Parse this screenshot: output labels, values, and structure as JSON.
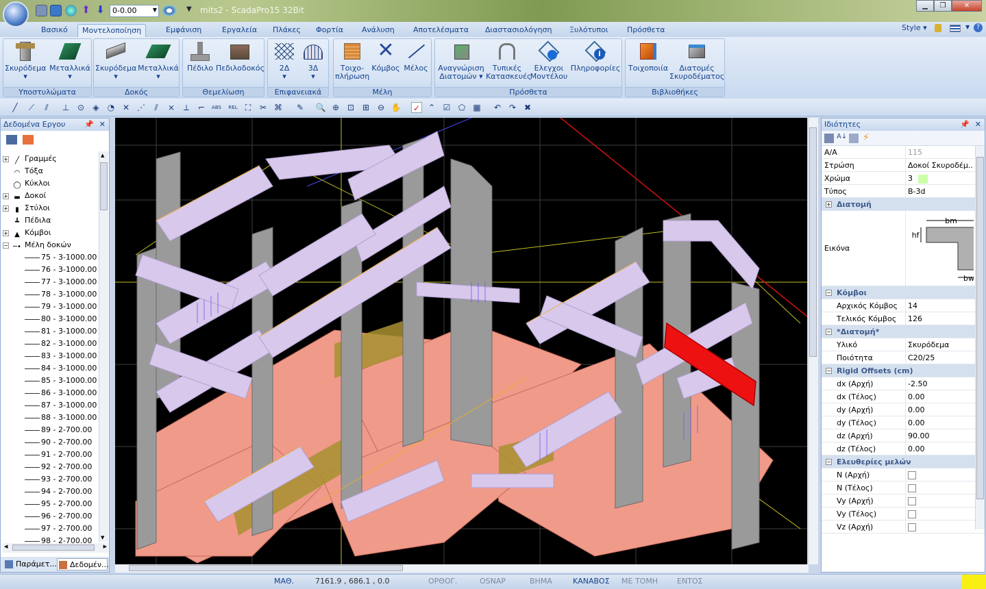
{
  "window": {
    "title": "mits2 - ScadaPro15 32Bit",
    "quick_combo_value": "0-0.00"
  },
  "menu_tabs": [
    "Βασικό",
    "Μοντελοποίηση",
    "Εμφάνιση",
    "Εργαλεία",
    "Πλάκες",
    "Φορτία",
    "Ανάλυση",
    "Αποτελέσματα",
    "Διαστασιολόγηση",
    "Ξυλότυποι",
    "Πρόσθετα"
  ],
  "menu_right": {
    "style_label": "Style"
  },
  "ribbon": {
    "columns": {
      "name": "Υποστυλώματα",
      "b1": "Σκυρόδεμα",
      "b2": "Μεταλλικά"
    },
    "beams": {
      "name": "Δοκός",
      "b1": "Σκυρόδεμα",
      "b2": "Μεταλλικά"
    },
    "foundation": {
      "name": "Θεμελίωση",
      "b1": "Πέδιλο",
      "b2": "Πεδιλοδοκός"
    },
    "surfaces": {
      "name": "Επιφανειακά",
      "b1": "2Δ",
      "b2": "3Δ"
    },
    "members": {
      "name": "Μέλη",
      "b1a": "Τοιχο-",
      "b1b": "πλήρωση",
      "b2": "Κόμβος",
      "b3": "Μέλος"
    },
    "extras": {
      "name": "Πρόσθετα",
      "b1a": "Αναγνώριση",
      "b1b": "Διατομών",
      "b2a": "Τυπικές",
      "b2b": "Κατασκευές",
      "b3a": "Ελεγχοι",
      "b3b": "Μοντέλου",
      "b4": "Πληροφορίες"
    },
    "libraries": {
      "name": "Βιβλιοθήκες",
      "b1": "Τοιχοποιία",
      "b2a": "Διατομές",
      "b2b": "Σκυροδέματος"
    }
  },
  "left_panel": {
    "title": "Δεδομένα Εργου",
    "tree_top": [
      {
        "label": "Γραμμές",
        "icon": "line-icon"
      },
      {
        "label": "Τόξα",
        "icon": "arc-icon"
      },
      {
        "label": "Κύκλοι",
        "icon": "circle-icon"
      },
      {
        "label": "Δοκοί",
        "icon": "beam-icon"
      },
      {
        "label": "Στύλοι",
        "icon": "column-icon"
      },
      {
        "label": "Πέδιλα",
        "icon": "footing-icon"
      },
      {
        "label": "Κόμβοι",
        "icon": "node-icon"
      },
      {
        "label": "Μέλη δοκών",
        "icon": "member-icon"
      }
    ],
    "members": [
      "75 - 3-1000.00",
      "76 - 3-1000.00",
      "77 - 3-1000.00",
      "78 - 3-1000.00",
      "79 - 3-1000.00",
      "80 - 3-1000.00",
      "81 - 3-1000.00",
      "82 - 3-1000.00",
      "83 - 3-1000.00",
      "84 - 3-1000.00",
      "85 - 3-1000.00",
      "86 - 3-1000.00",
      "87 - 3-1000.00",
      "88 - 3-1000.00",
      "89 - 2-700.00",
      "90 - 2-700.00",
      "91 - 2-700.00",
      "92 - 2-700.00",
      "93 - 2-700.00",
      "94 - 2-700.00",
      "95 - 2-700.00",
      "96 - 2-700.00",
      "97 - 2-700.00",
      "98 - 2-700.00"
    ],
    "bottom_tabs": [
      "Παράμετ...",
      "Δεδομέν..."
    ]
  },
  "properties": {
    "title": "Ιδιότητες",
    "aa": {
      "name": "Α/Α",
      "value": "115"
    },
    "layer": {
      "name": "Στρώση",
      "value": "Δοκοί Σκυροδέμ..."
    },
    "color": {
      "name": "Χρώμα",
      "value": "3",
      "swatch": "#ccffaa"
    },
    "type": {
      "name": "Τύπος",
      "value": "B-3d"
    },
    "cat_section": "Διατομή",
    "image": {
      "name": "Εικόνα",
      "bm": "bm",
      "hf": "hf",
      "bw": "bw"
    },
    "cat_nodes": "Κόμβοι",
    "start_node": {
      "name": "Αρχικός Κόμβος",
      "value": "14"
    },
    "end_node": {
      "name": "Τελικός Κόμβος",
      "value": "126"
    },
    "cat_section2": "*Διατομή*",
    "material": {
      "name": "Υλικό",
      "value": "Σκυρόδεμα"
    },
    "quality": {
      "name": "Ποιότητα",
      "value": "C20/25"
    },
    "cat_offsets": "Rigid Offsets (cm)",
    "offsets": [
      {
        "name": "dx (Αρχή)",
        "value": "-2.50"
      },
      {
        "name": "dx (Τέλος)",
        "value": "0.00"
      },
      {
        "name": "dy (Αρχή)",
        "value": "0.00"
      },
      {
        "name": "dy (Τέλος)",
        "value": "0.00"
      },
      {
        "name": "dz (Αρχή)",
        "value": "90.00"
      },
      {
        "name": "dz (Τέλος)",
        "value": "0.00"
      }
    ],
    "cat_releases": "Ελευθερίες μελών",
    "releases": [
      "N (Αρχή)",
      "N (Τέλος)",
      "Vy (Αρχή)",
      "Vy (Τέλος)",
      "Vz (Αρχή)"
    ]
  },
  "status": {
    "math": "ΜΑΘ.",
    "coords": "7161.9 , 686.1 , 0.0",
    "ortho": "ΟΡΘΟΓ.",
    "osnap": "OSNAP",
    "step": "ΒΗΜΑ",
    "grid": "ΚΑΝΑΒΟΣ",
    "section": "ΜΕ ΤΟΜΗ",
    "inside": "ΕΝΤΟΣ"
  },
  "colors": {
    "viewport_bg": "#000000",
    "slab": "#f09a8a",
    "column": "#9a9a9a",
    "beam": "#d8c8ec",
    "selected": "#ee1111",
    "wall": "#a89030"
  }
}
